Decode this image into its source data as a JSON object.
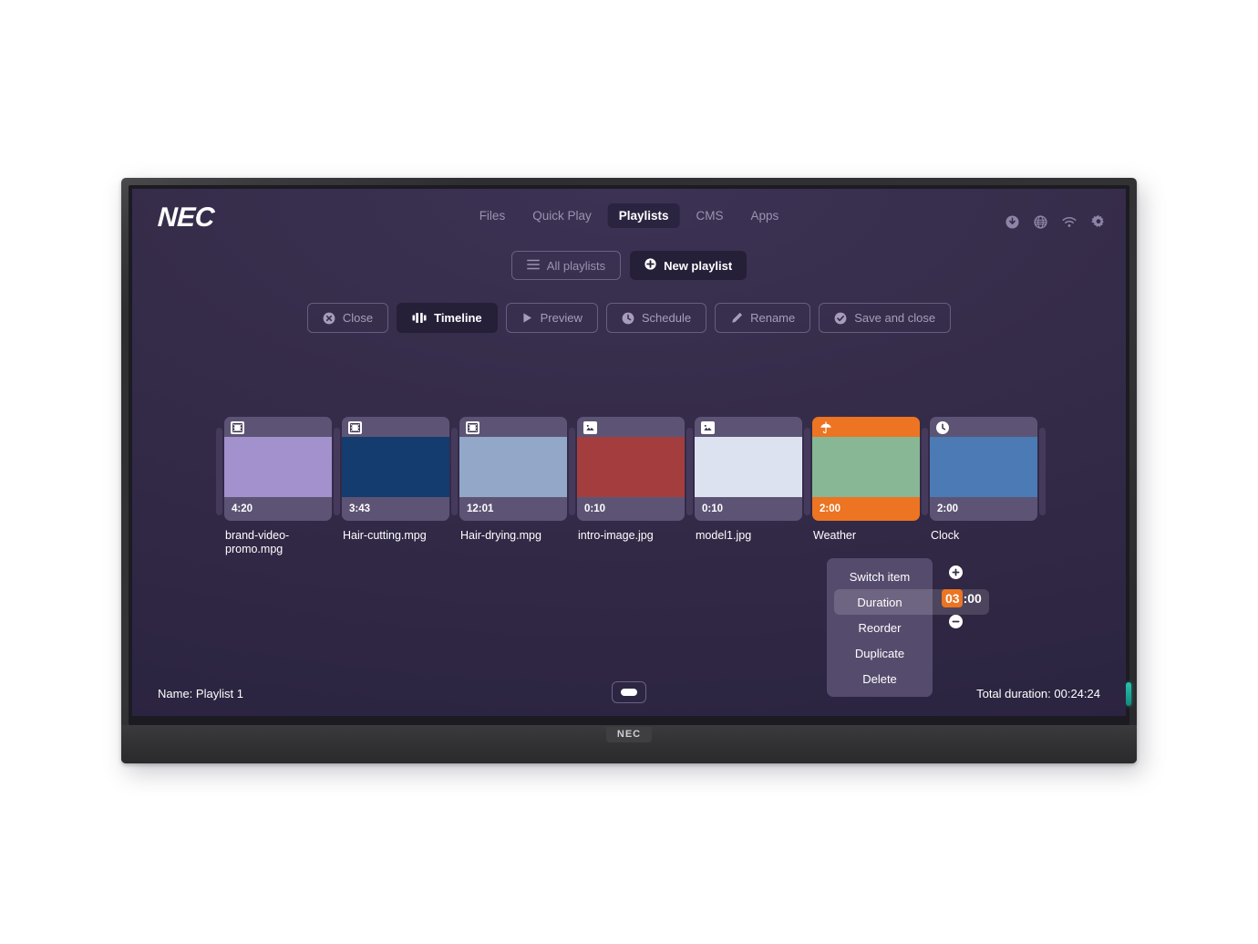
{
  "brand": {
    "logo": "NEC",
    "bezel_logo": "NEC"
  },
  "header": {
    "nav": [
      {
        "label": "Files",
        "active": false
      },
      {
        "label": "Quick Play",
        "active": false
      },
      {
        "label": "Playlists",
        "active": true
      },
      {
        "label": "CMS",
        "active": false
      },
      {
        "label": "Apps",
        "active": false
      }
    ],
    "status_icons": [
      "download-icon",
      "globe-icon",
      "wifi-icon",
      "gear-icon"
    ]
  },
  "playlist_bar": {
    "all_playlists_label": "All playlists",
    "new_playlist_label": "New playlist"
  },
  "toolbar": {
    "buttons": [
      {
        "label": "Close",
        "icon": "close-circle-icon",
        "active": false
      },
      {
        "label": "Timeline",
        "icon": "timeline-icon",
        "active": true
      },
      {
        "label": "Preview",
        "icon": "play-icon",
        "active": false
      },
      {
        "label": "Schedule",
        "icon": "clock-icon",
        "active": false
      },
      {
        "label": "Rename",
        "icon": "pencil-icon",
        "active": false
      },
      {
        "label": "Save and close",
        "icon": "check-circle-icon",
        "active": false
      }
    ]
  },
  "timeline": {
    "items": [
      {
        "name": "brand-video-promo.mpg",
        "duration": "4:20",
        "icon": "film-icon",
        "media_color": "#a391cd",
        "selected": false
      },
      {
        "name": "Hair-cutting.mpg",
        "duration": "3:43",
        "icon": "film-icon",
        "media_color": "#143c6e",
        "selected": false
      },
      {
        "name": "Hair-drying.mpg",
        "duration": "12:01",
        "icon": "film-icon",
        "media_color": "#93a8c8",
        "selected": false
      },
      {
        "name": "intro-image.jpg",
        "duration": "0:10",
        "icon": "image-icon",
        "media_color": "#a43e3e",
        "selected": false
      },
      {
        "name": "model1.jpg",
        "duration": "0:10",
        "icon": "image-icon",
        "media_color": "#dde2f0",
        "selected": false
      },
      {
        "name": "Weather",
        "duration": "2:00",
        "icon": "umbrella-icon",
        "media_color": "#88b795",
        "selected": true
      },
      {
        "name": "Clock",
        "duration": "2:00",
        "icon": "clock-icon",
        "media_color": "#4b7ab5",
        "selected": false
      }
    ]
  },
  "context_menu": {
    "items": [
      {
        "label": "Switch item",
        "highlighted": false
      },
      {
        "label": "Duration",
        "highlighted": true
      },
      {
        "label": "Reorder",
        "highlighted": false
      },
      {
        "label": "Duplicate",
        "highlighted": false
      },
      {
        "label": "Delete",
        "highlighted": false
      }
    ],
    "duration_minutes": "03",
    "duration_separator": ":",
    "duration_seconds": "00",
    "increase_icon": "plus-circle-icon",
    "decrease_icon": "minus-circle-icon"
  },
  "footer": {
    "name_label": "Name: Playlist 1",
    "total_duration_label": "Total duration: 00:24:24"
  },
  "colors": {
    "screen_bg": "#362d4b",
    "accent_orange": "#ec7422",
    "tile_frame": "#5d5475",
    "muted_text": "#9b92b0",
    "led": "#25c3b0"
  }
}
